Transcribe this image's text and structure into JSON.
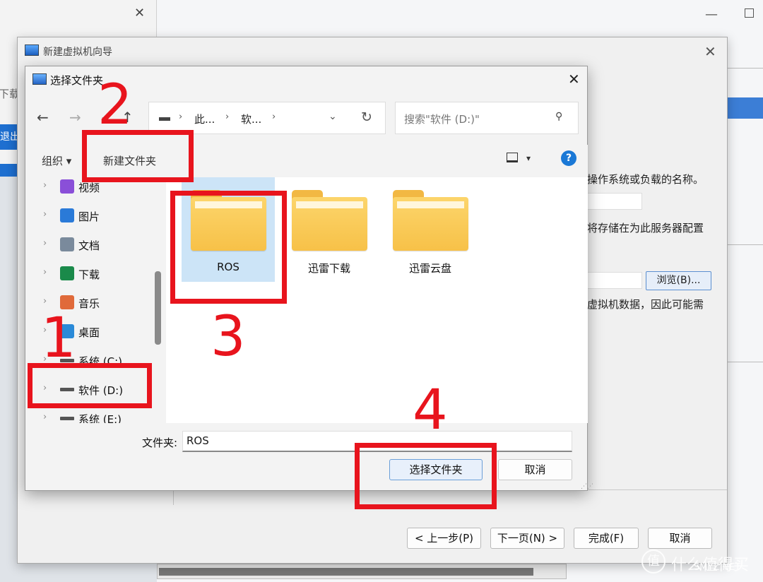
{
  "bg_left": {
    "close": "✕",
    "frag_download": "下载",
    "frag_exit": "退出"
  },
  "wizard": {
    "title": "新建虚拟机向导",
    "close": "✕",
    "text1": "操作系统或负载的名称。",
    "text2": "将存储在为此服务器配置",
    "text3": "虚拟机数据，因此可能需",
    "browse": "浏览(B)...",
    "buttons": {
      "prev": "< 上一步(P)",
      "next": "下一页(N) >",
      "finish": "完成(F)",
      "cancel": "取消"
    }
  },
  "dialog": {
    "title": "选择文件夹",
    "close": "✕",
    "nav": {
      "back": "←",
      "forward": "→",
      "recent": "⌄",
      "up": "↑"
    },
    "address": {
      "seg1": "此...",
      "seg2": "软...",
      "sep": "›",
      "dropdown": "⌄",
      "refresh": "↻"
    },
    "search_placeholder": "搜索\"软件 (D:)\"",
    "search_icon": "⚲",
    "toolbar": {
      "organize": "组织 ▾",
      "new_folder": "新建文件夹",
      "view_dropdown": "▾",
      "help": "?"
    },
    "sidebar": [
      {
        "label": "视频",
        "icon": "video-icon",
        "color": "#8a4fd8"
      },
      {
        "label": "图片",
        "icon": "picture-icon",
        "color": "#2a7ad8"
      },
      {
        "label": "文档",
        "icon": "document-icon",
        "color": "#7a8a9c"
      },
      {
        "label": "下载",
        "icon": "download-icon",
        "color": "#1a8a4a"
      },
      {
        "label": "音乐",
        "icon": "music-icon",
        "color": "#e06a3a"
      },
      {
        "label": "桌面",
        "icon": "desktop-icon",
        "color": "#2a8ad8"
      },
      {
        "label": "系统 (C:)",
        "icon": "drive-icon",
        "color": "#555555"
      },
      {
        "label": "软件 (D:)",
        "icon": "drive-icon",
        "color": "#555555"
      },
      {
        "label": "系统 (E:)",
        "icon": "drive-icon",
        "color": "#555555"
      }
    ],
    "folders": [
      {
        "name": "ROS"
      },
      {
        "name": "迅雷下载"
      },
      {
        "name": "迅雷云盘"
      }
    ],
    "folder_label": "文件夹:",
    "folder_value": "ROS",
    "select_button": "选择文件夹",
    "cancel_button": "取消"
  },
  "annotations": {
    "n1": "1",
    "n2": "2",
    "n3": "3",
    "n4": "4",
    "color": "#e8141d"
  },
  "watermark": {
    "logo": "值",
    "text": "什么值得买",
    "site": "SMYZ.NET"
  }
}
